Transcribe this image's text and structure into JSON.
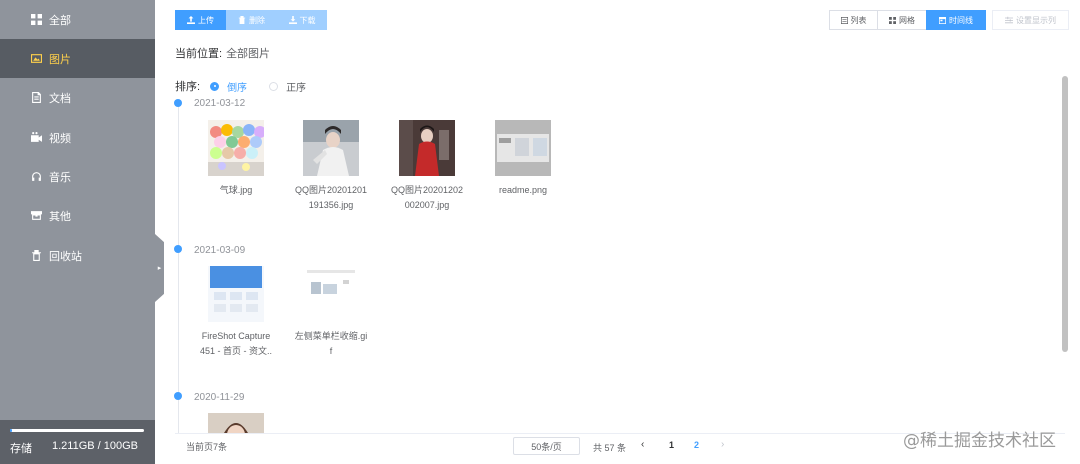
{
  "sidebar": {
    "items": [
      {
        "label": "全部",
        "icon": "grid-icon",
        "active": false
      },
      {
        "label": "图片",
        "icon": "image-icon",
        "active": true
      },
      {
        "label": "文档",
        "icon": "document-icon",
        "active": false
      },
      {
        "label": "视频",
        "icon": "video-icon",
        "active": false
      },
      {
        "label": "音乐",
        "icon": "headphones-icon",
        "active": false
      },
      {
        "label": "其他",
        "icon": "archive-icon",
        "active": false
      },
      {
        "label": "回收站",
        "icon": "recycle-bin-icon",
        "active": false
      }
    ],
    "storage": {
      "label": "存储",
      "value": "1.211GB / 100GB",
      "used_fraction": 0.012
    }
  },
  "toolbar": {
    "upload_label": "上传",
    "delete_label": "删除",
    "download_label": "下载"
  },
  "view_modes": {
    "list_label": "列表",
    "grid_label": "网格",
    "timeline_label": "时间线",
    "active": "timeline"
  },
  "settings_label": "设置显示列",
  "breadcrumb": {
    "prefix": "当前位置:",
    "current": "全部图片"
  },
  "sort": {
    "label": "排序:",
    "desc_label": "倒序",
    "asc_label": "正序",
    "selected": "desc"
  },
  "groups": [
    {
      "date": "2021-03-12",
      "files": [
        {
          "name": "气球.jpg",
          "thumb": "balloons"
        },
        {
          "name": "QQ图片20201201191356.jpg",
          "thumb": "portrait-white"
        },
        {
          "name": "QQ图片20201202002007.jpg",
          "thumb": "portrait-red"
        },
        {
          "name": "readme.png",
          "thumb": "screenshot-gray"
        }
      ]
    },
    {
      "date": "2021-03-09",
      "files": [
        {
          "name": "FireShot Capture 451 - 首页 - 资文..",
          "thumb": "webpage-blue"
        },
        {
          "name": "左侧菜单栏收缩.gif",
          "thumb": "webpage-white"
        }
      ]
    },
    {
      "date": "2020-11-29",
      "files": [
        {
          "name": "",
          "thumb": "portrait-partial"
        }
      ]
    }
  ],
  "footer": {
    "page_count": "当前页7条",
    "page_size": "50条/页",
    "total": "共 57 条",
    "prev": "‹",
    "next": "›",
    "pages": [
      "1",
      "2"
    ],
    "current_page": "2"
  },
  "watermark": "@稀土掘金技术社区",
  "colors": {
    "accent": "#409eff",
    "sidebar": "#8f949c",
    "sidebar_active": "#575c63",
    "active_text": "#ffd04b"
  }
}
